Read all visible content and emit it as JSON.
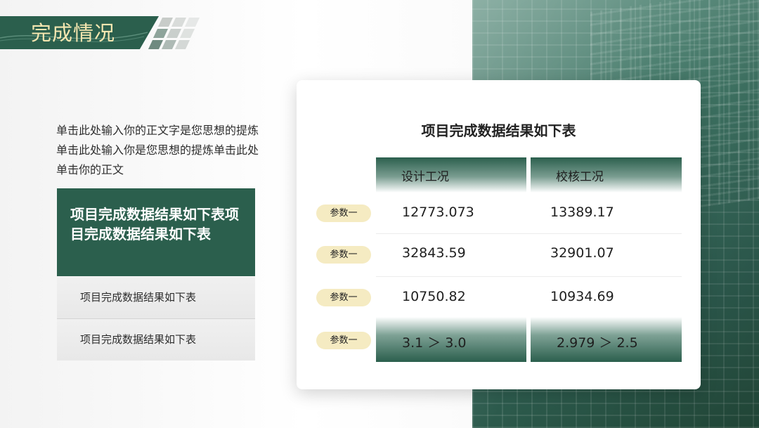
{
  "header": {
    "title": "完成情况"
  },
  "intro": {
    "text": "单击此处输入你的正文字是您思想的提炼单击此处输入你是您思想的提炼单击此处单击你的正文"
  },
  "summary": {
    "text": "项目完成数据结果如下表项目完成数据结果如下表"
  },
  "list": [
    {
      "label": "项目完成数据结果如下表"
    },
    {
      "label": "项目完成数据结果如下表"
    }
  ],
  "table": {
    "title": "项目完成数据结果如下表",
    "headers": [
      "设计工况",
      "校核工况"
    ],
    "rows": [
      {
        "param": "参数一",
        "design": "12773.073",
        "check": "13389.17"
      },
      {
        "param": "参数一",
        "design": "32843.59",
        "check": "32901.07"
      },
      {
        "param": "参数一",
        "design": "10750.82",
        "check": "10934.69"
      },
      {
        "param": "参数一",
        "design": "3.1 ＞ 3.0",
        "check": "2.979 ＞ 2.5"
      }
    ]
  },
  "colors": {
    "brand_green": "#2b5f4d",
    "accent_gold": "#f4e6b0",
    "pill_bg": "#f5ebc2"
  }
}
